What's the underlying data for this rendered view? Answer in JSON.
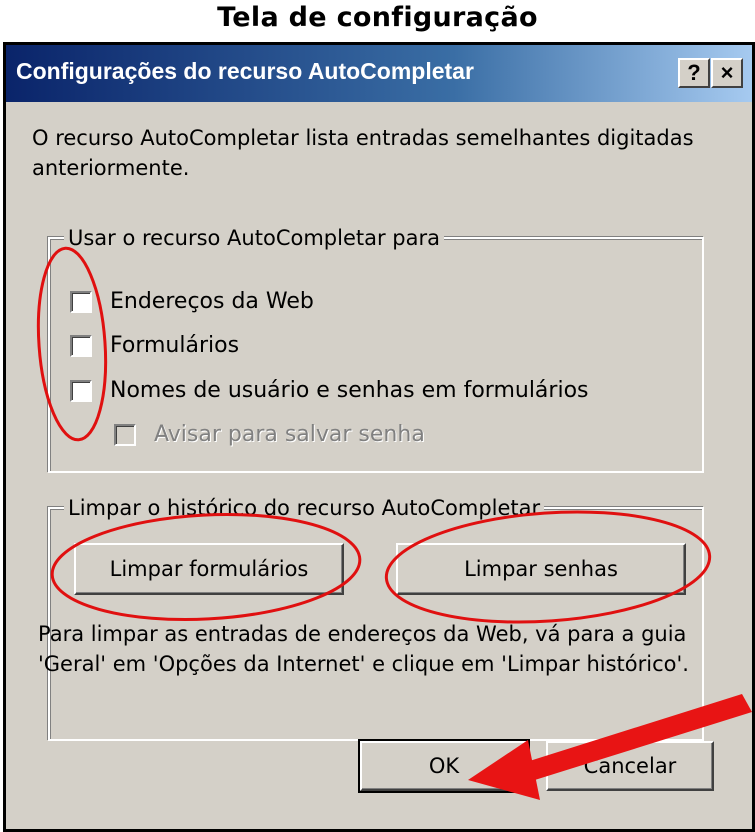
{
  "page_title": "Tela de configuração",
  "dialog": {
    "title": "Configurações do recurso AutoCompletar",
    "help_label": "?",
    "close_label": "×",
    "description": "O recurso AutoCompletar lista entradas semelhantes digitadas anteriormente.",
    "use_group": {
      "legend": "Usar o recurso AutoCompletar para",
      "items": [
        {
          "label": "Endereços da Web",
          "checked": false,
          "enabled": true
        },
        {
          "label": "Formulários",
          "checked": false,
          "enabled": true
        },
        {
          "label": "Nomes de usuário e senhas em formulários",
          "checked": false,
          "enabled": true
        },
        {
          "label": "Avisar para salvar senha",
          "checked": false,
          "enabled": false
        }
      ]
    },
    "clear_group": {
      "legend": "Limpar o histórico do recurso AutoCompletar",
      "clear_forms_label": "Limpar formulários",
      "clear_passwords_label": "Limpar senhas",
      "note": "Para limpar as entradas de endereços da Web, vá para a guia 'Geral' em 'Opções da Internet' e clique em 'Limpar histórico'."
    },
    "ok_label": "OK",
    "cancel_label": "Cancelar"
  },
  "annotation_colors": {
    "circle": "#e01010",
    "arrow": "#e81414"
  }
}
